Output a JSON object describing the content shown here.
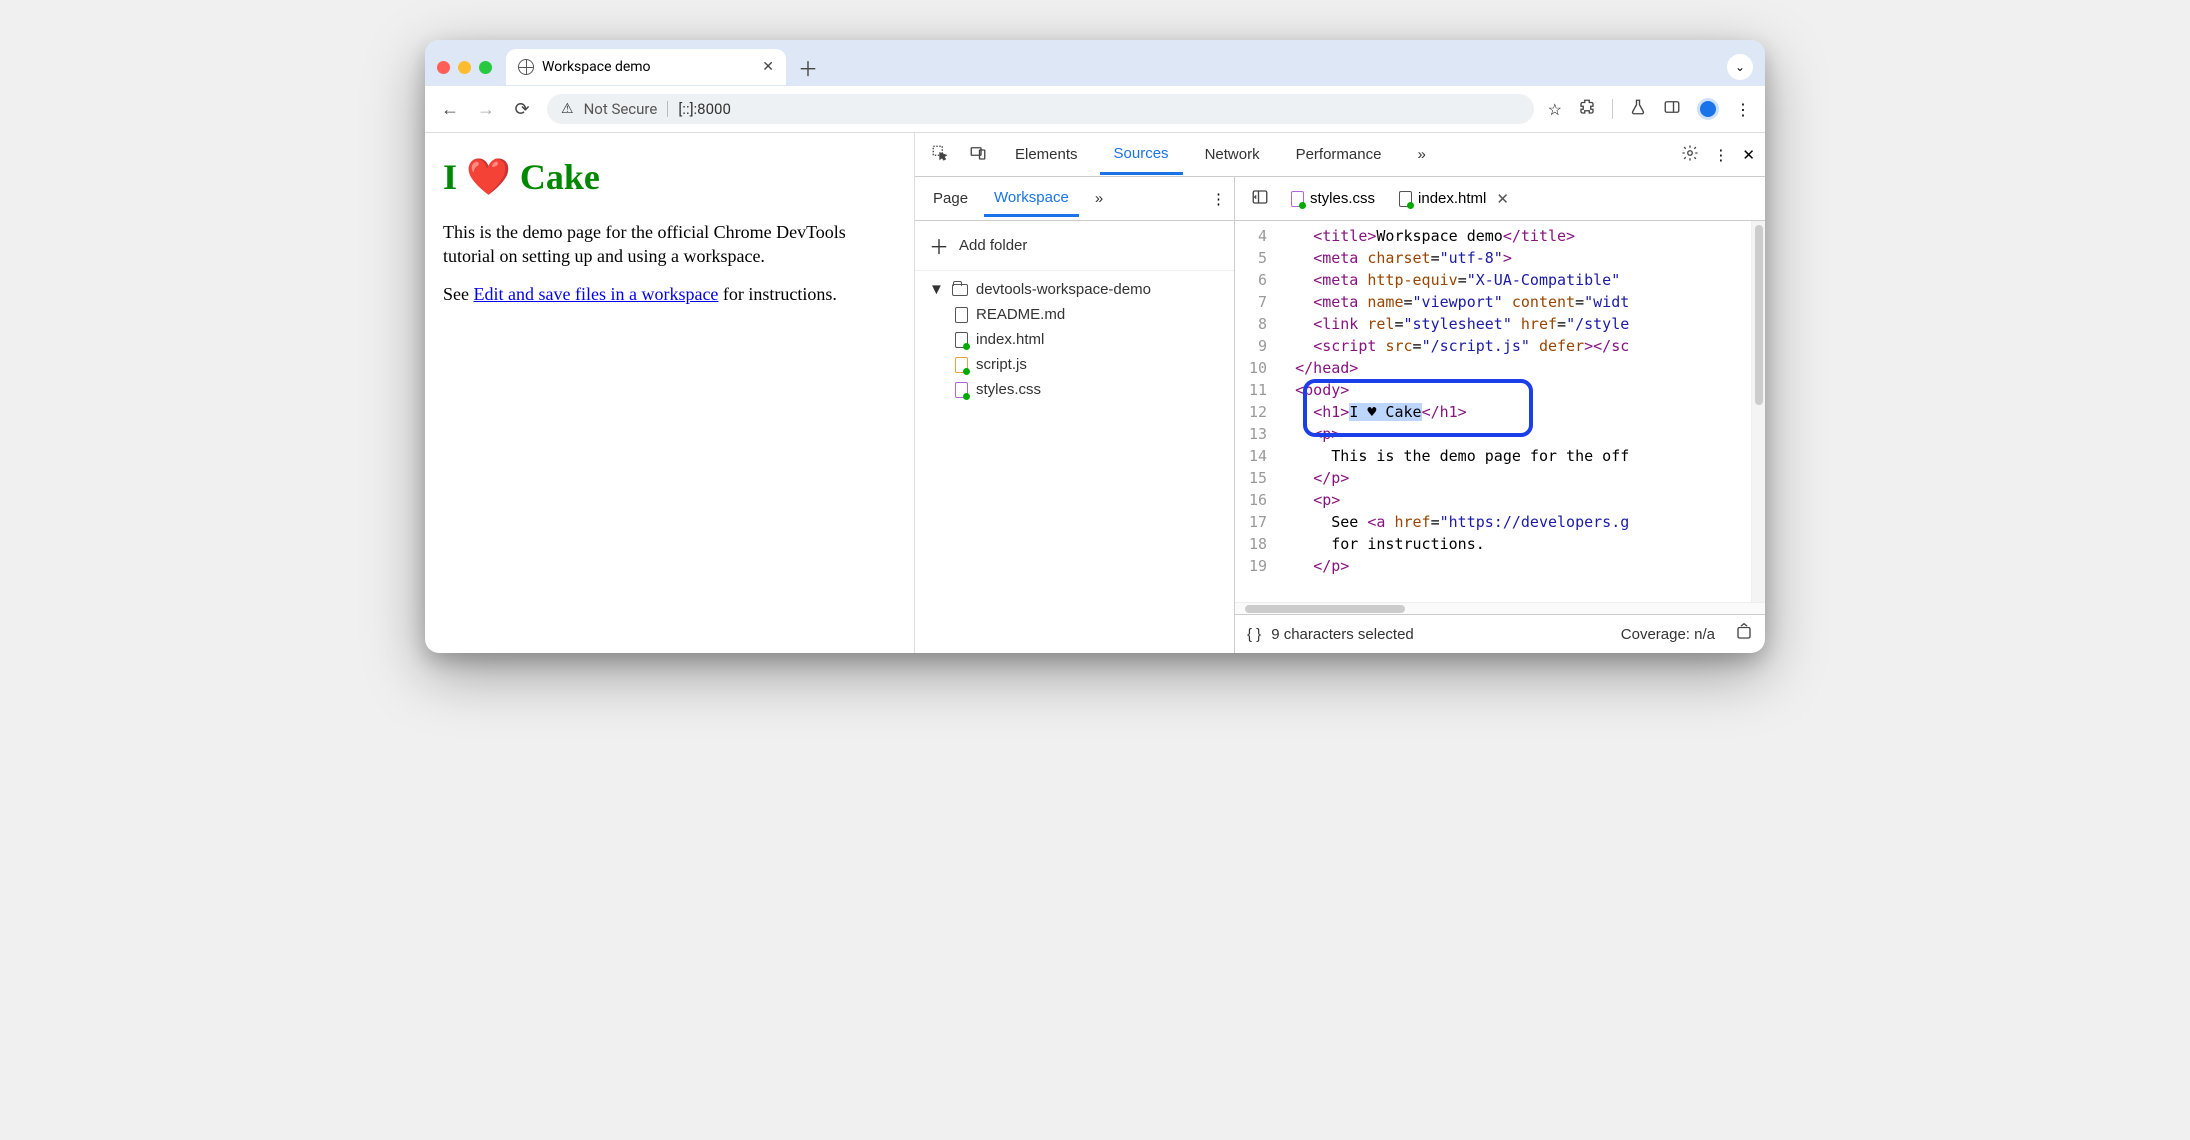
{
  "browser": {
    "tab_title": "Workspace demo",
    "omnibox": {
      "security_label": "Not Secure",
      "url": "[::]:8000"
    }
  },
  "page": {
    "heading": "I ❤️ Cake",
    "p1": "This is the demo page for the official Chrome DevTools tutorial on setting up and using a workspace.",
    "p2_pre": "See ",
    "p2_link": "Edit and save files in a workspace",
    "p2_post": " for instructions."
  },
  "devtools": {
    "panels": [
      "Elements",
      "Sources",
      "Network",
      "Performance"
    ],
    "active_panel": "Sources",
    "sources_nav": {
      "tabs": [
        "Page",
        "Workspace"
      ],
      "active": "Workspace",
      "add_folder": "Add folder",
      "folder": "devtools-workspace-demo",
      "files": [
        "README.md",
        "index.html",
        "script.js",
        "styles.css"
      ]
    },
    "editor": {
      "open_tabs": [
        "styles.css",
        "index.html"
      ],
      "active_tab": "index.html",
      "line_start": 4,
      "lines": [
        {
          "n": 4,
          "html": "    <span class='t-tag'>&lt;title&gt;</span><span class='t-txt'>Workspace demo</span><span class='t-tag'>&lt;/title&gt;</span>"
        },
        {
          "n": 5,
          "html": "    <span class='t-tag'>&lt;meta</span> <span class='t-attr'>charset</span>=<span class='t-str'>\"utf-8\"</span><span class='t-tag'>&gt;</span>"
        },
        {
          "n": 6,
          "html": "    <span class='t-tag'>&lt;meta</span> <span class='t-attr'>http-equiv</span>=<span class='t-str'>\"X-UA-Compatible\"</span>"
        },
        {
          "n": 7,
          "html": "    <span class='t-tag'>&lt;meta</span> <span class='t-attr'>name</span>=<span class='t-str'>\"viewport\"</span> <span class='t-attr'>content</span>=<span class='t-str'>\"widt</span>"
        },
        {
          "n": 8,
          "html": "    <span class='t-tag'>&lt;link</span> <span class='t-attr'>rel</span>=<span class='t-str'>\"stylesheet\"</span> <span class='t-attr'>href</span>=<span class='t-str'>\"/style</span>"
        },
        {
          "n": 9,
          "html": "    <span class='t-tag'>&lt;script</span> <span class='t-attr'>src</span>=<span class='t-str'>\"/script.js\"</span> <span class='t-attr'>defer</span><span class='t-tag'>&gt;&lt;/sc</span>"
        },
        {
          "n": 10,
          "html": "  <span class='t-tag'>&lt;/head&gt;</span>"
        },
        {
          "n": 11,
          "html": "  <span class='t-tag'>&lt;body&gt;</span>"
        },
        {
          "n": 12,
          "html": "    <span class='t-tag'>&lt;h1&gt;</span><span class='sel t-txt'>I ♥ Cake</span><span class='t-tag'>&lt;/h1&gt;</span>"
        },
        {
          "n": 13,
          "html": "    <span class='t-tag'>&lt;p&gt;</span>"
        },
        {
          "n": 14,
          "html": "      <span class='t-txt'>This is the demo page for the off</span>"
        },
        {
          "n": 15,
          "html": "    <span class='t-tag'>&lt;/p&gt;</span>"
        },
        {
          "n": 16,
          "html": "    <span class='t-tag'>&lt;p&gt;</span>"
        },
        {
          "n": 17,
          "html": "      <span class='t-txt'>See </span><span class='t-tag'>&lt;a</span> <span class='t-attr'>href</span>=<span class='t-str'>\"https://developers.g</span>"
        },
        {
          "n": 18,
          "html": "      <span class='t-txt'>for instructions.</span>"
        },
        {
          "n": 19,
          "html": "    <span class='t-tag'>&lt;/p&gt;</span>"
        }
      ]
    },
    "status": {
      "selection": "9 characters selected",
      "coverage": "Coverage: n/a"
    }
  }
}
